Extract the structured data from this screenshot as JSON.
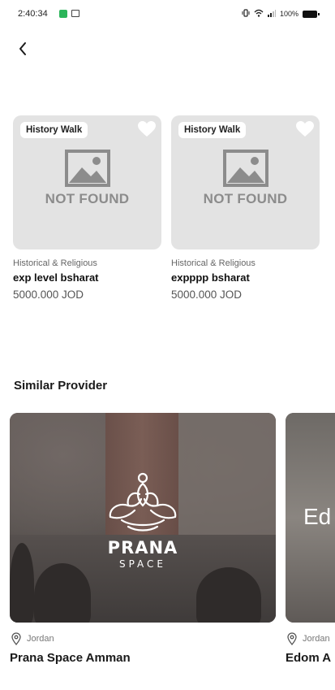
{
  "status_bar": {
    "time": "2:40:34",
    "battery": "100%"
  },
  "experiences": [
    {
      "tag": "History Walk",
      "placeholder_text": "NOT FOUND",
      "category": "Historical & Religious",
      "title": "exp level bsharat",
      "price": "5000.000 JOD"
    },
    {
      "tag": "History Walk",
      "placeholder_text": "NOT FOUND",
      "category": "Historical & Religious",
      "title": "expppp bsharat",
      "price": "5000.000 JOD"
    }
  ],
  "similar_provider": {
    "title": "Similar Provider",
    "providers": [
      {
        "logo_main": "PRANA",
        "logo_sub": "SPACE",
        "location": "Jordan",
        "name": "Prana Space Amman"
      },
      {
        "logo_main": "Ed",
        "location": "Jordan",
        "name": "Edom A"
      }
    ]
  },
  "icons": {
    "back": "chevron-left-icon",
    "favorite": "heart-icon",
    "image_placeholder": "image-icon",
    "location": "map-pin-icon"
  }
}
